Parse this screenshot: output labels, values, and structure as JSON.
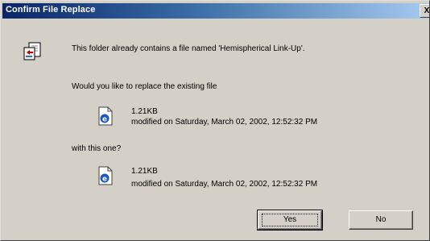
{
  "dialog": {
    "title": "Confirm File Replace",
    "close_glyph": "X",
    "message": "This folder already contains a file named 'Hemispherical Link-Up'.",
    "question": "Would you like to replace the existing file",
    "existing_file": {
      "size": "1.21KB",
      "modified": "modified on Saturday, March 02, 2002, 12:52:32 PM",
      "icon": "ie-document-icon"
    },
    "with_label": "with this one?",
    "new_file": {
      "size": "1.21KB",
      "modified": "modified on Saturday, March 02, 2002, 12:52:32 PM",
      "icon": "ie-document-icon"
    },
    "buttons": {
      "yes": "Yes",
      "no": "No"
    },
    "colors": {
      "titlebar_start": "#0a246a",
      "titlebar_end": "#a6caf0",
      "face": "#d4d0c8"
    }
  }
}
